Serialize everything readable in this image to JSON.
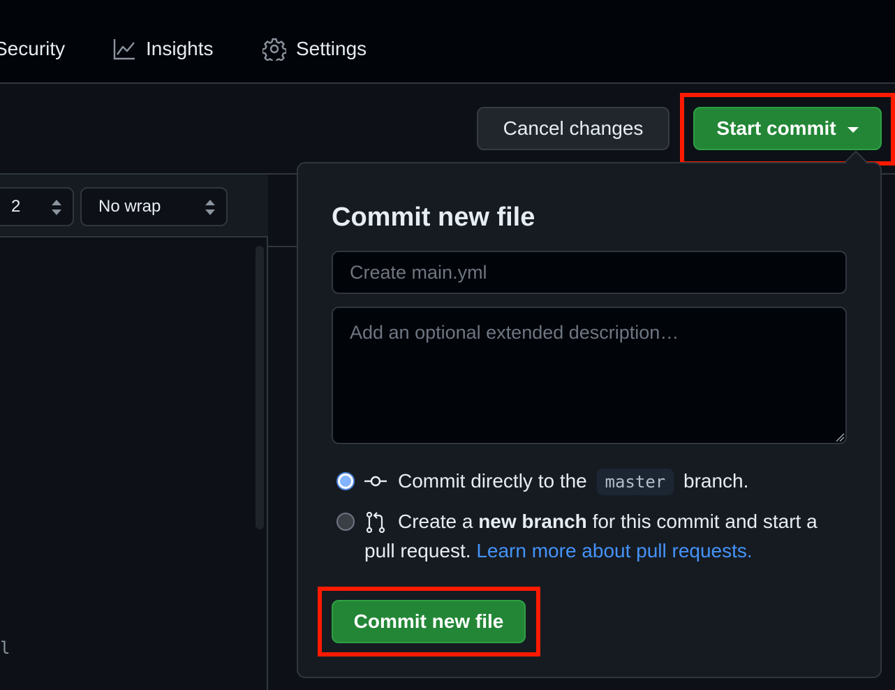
{
  "nav": {
    "security_label": "Security",
    "insights_label": "Insights",
    "settings_label": "Settings"
  },
  "toolbar": {
    "cancel_label": "Cancel changes",
    "start_commit_label": "Start commit"
  },
  "editor": {
    "indent_size": "2",
    "wrap_mode": "No wrap",
    "code_fragment": "l"
  },
  "commit_popup": {
    "title": "Commit new file",
    "summary_placeholder": "Create main.yml",
    "description_placeholder": "Add an optional extended description…",
    "option_direct": {
      "prefix": "Commit directly to the",
      "branch": "master",
      "suffix": "branch.",
      "selected": true
    },
    "option_new_branch": {
      "prefix": "Create a",
      "bold": "new branch",
      "suffix": "for this commit and start a",
      "line2": "pull request.",
      "link": "Learn more about pull requests.",
      "selected": false
    },
    "commit_button_label": "Commit new file"
  },
  "colors": {
    "accent_green": "#238636",
    "highlight_red": "#ff1a00",
    "link_blue": "#4493f8"
  }
}
